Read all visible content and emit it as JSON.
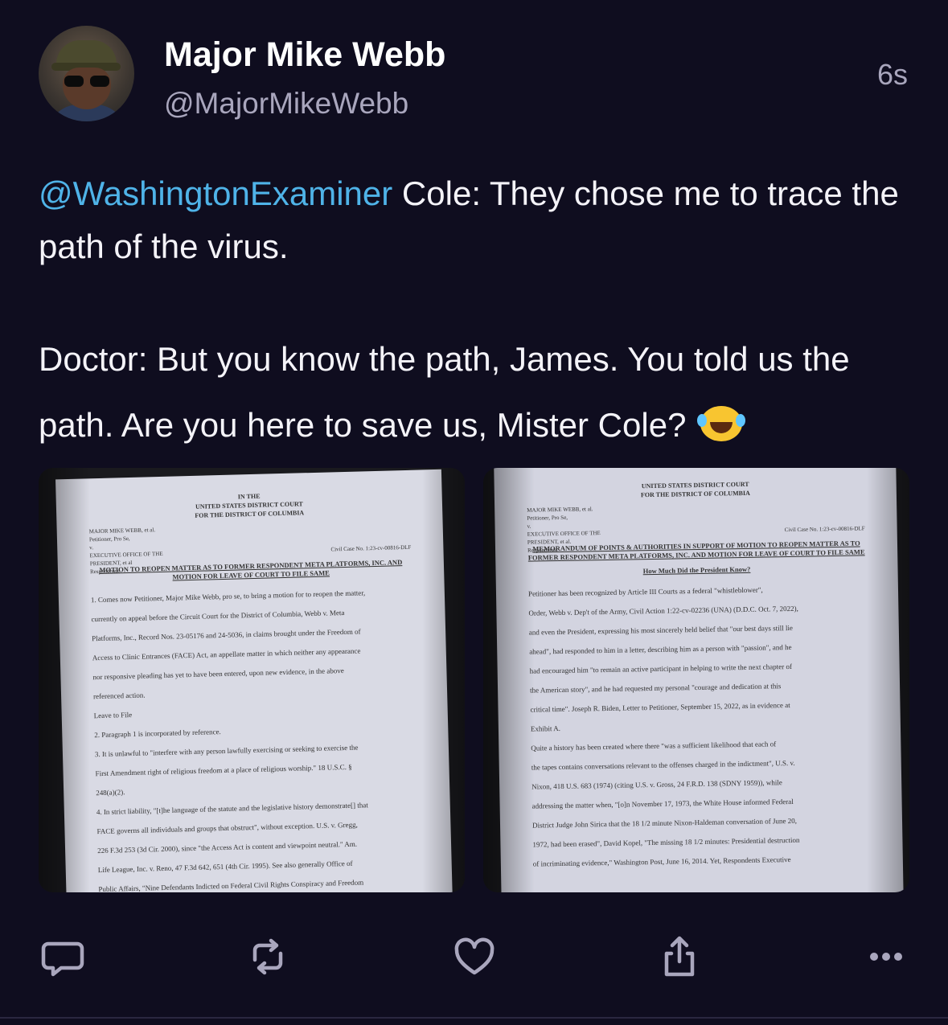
{
  "post": {
    "author_name": "Major Mike Webb",
    "author_handle": "@MajorMikeWebb",
    "timestamp": "6s",
    "mention": "@WashingtonExaminer",
    "text_line1_rest": " Cole: They chose me to trace the path of the virus.",
    "text_para2": "Doctor: But you know the path, James. You told us the path. Are you here to save us, Mister Cole?",
    "emoji": "face-with-tears-of-joy"
  },
  "images": {
    "left": {
      "court_header": [
        "IN THE",
        "UNITED STATES DISTRICT COURT",
        "FOR THE DISTRICT OF COLUMBIA"
      ],
      "parties": [
        "MAJOR MIKE WEBB, et al.",
        "Petitioner, Pro Se,",
        "v.",
        "EXECUTIVE OFFICE OF THE",
        "PRESIDENT, et al",
        "Respondents."
      ],
      "case_no": "Civil Case No. 1:23-cv-00816-DLF",
      "title": "MOTION TO REOPEN MATTER AS TO FORMER RESPONDENT META PLATFORMS, INC. AND MOTION FOR LEAVE OF COURT TO FILE SAME",
      "lines": [
        "1. Comes now Petitioner, Major Mike Webb, pro se, to bring a motion for to reopen the matter,",
        "currently on appeal before the Circuit Court for the District of Columbia, Webb v. Meta",
        "Platforms, Inc., Record Nos. 23-05176 and 24-5036, in claims brought under the Freedom of",
        "Access to Clinic Entrances (FACE) Act, an appellate matter in which neither any appearance",
        "nor responsive pleading has yet to have been entered, upon new evidence, in the above",
        "referenced action.",
        "Leave to File",
        "2. Paragraph 1 is incorporated by reference.",
        "3. It is unlawful to \"interfere with any person lawfully exercising or seeking to exercise the",
        "First Amendment right of religious freedom at a place of religious worship.\" 18 U.S.C. §",
        "248(a)(2).",
        "4. In strict liability, \"[t]he language of the statute and the legislative history demonstrate[] that",
        "FACE governs all individuals and groups that obstruct\", without exception. U.S. v. Gregg,",
        "226 F.3d 253 (3d Cir. 2000), since \"the Access Act is content and viewpoint neutral.\" Am.",
        "Life League, Inc. v. Reno, 47 F.3d 642, 651 (4th Cir. 1995). See also generally Office of",
        "Public Affairs, \"Nine Defendants Indicted on Federal Civil Rights Conspiracy and Freedom"
      ]
    },
    "right": {
      "court_header": [
        "UNITED STATES DISTRICT COURT",
        "FOR THE DISTRICT OF COLUMBIA"
      ],
      "parties": [
        "MAJOR MIKE WEBB, et al.",
        "Petitioner, Pro Se,",
        "v.",
        "EXECUTIVE OFFICE OF THE",
        "PRESIDENT, et al.",
        "Respondents."
      ],
      "case_no": "Civil Case No. 1:23-cv-00816-DLF",
      "title": "MEMORANDUM OF POINTS & AUTHORITIES IN SUPPORT OF MOTION TO REOPEN MATTER AS TO FORMER RESPONDENT META PLATFORMS, INC. AND MOTION FOR LEAVE OF COURT TO FILE SAME",
      "subtitle": "How Much Did the President Know?",
      "lines": [
        "Petitioner has been recognized by Article III Courts as a federal \"whistleblower\",",
        "Order, Webb v. Dep't of the Army, Civil Action 1:22-cv-02236 (UNA) (D.D.C. Oct. 7, 2022),",
        "and even the President, expressing his most sincerely held belief that \"our best days still lie",
        "ahead\", had responded to him in a letter, describing him as a person with \"passion\", and he",
        "had encouraged him \"to remain an active participant in helping to write the next chapter of",
        "the American story\", and he had requested my personal \"courage and dedication at this",
        "critical time\". Joseph R. Biden, Letter to Petitioner, September 15, 2022, as in evidence at",
        "Exhibit A.",
        "Quite a history has been created where there \"was a sufficient likelihood that each of",
        "the tapes contains conversations relevant to the offenses charged in the indictment\", U.S. v.",
        "Nixon, 418 U.S. 683 (1974) (citing U.S. v. Gross, 24 F.R.D. 138 (SDNY 1959)), while",
        "addressing the matter when, \"[o]n November 17, 1973, the White House informed Federal",
        "District Judge John Sirica that the 18 1/2 minute Nixon-Haldeman conversation of June 20,",
        "1972, had been erased\", David Kopel, \"The missing 18 1/2 minutes: Presidential destruction",
        "of incriminating evidence,\" Washington Post, June 16, 2014. Yet, Respondents Executive"
      ]
    }
  },
  "actions": [
    {
      "name": "reply",
      "icon": "speech-bubble-icon"
    },
    {
      "name": "repost",
      "icon": "repost-icon"
    },
    {
      "name": "like",
      "icon": "heart-icon"
    },
    {
      "name": "share",
      "icon": "share-icon"
    },
    {
      "name": "more",
      "icon": "more-dots-icon"
    }
  ],
  "colors": {
    "background": "#0f0d1f",
    "mention": "#4fb3e8",
    "secondary_text": "#a9a6bd"
  }
}
